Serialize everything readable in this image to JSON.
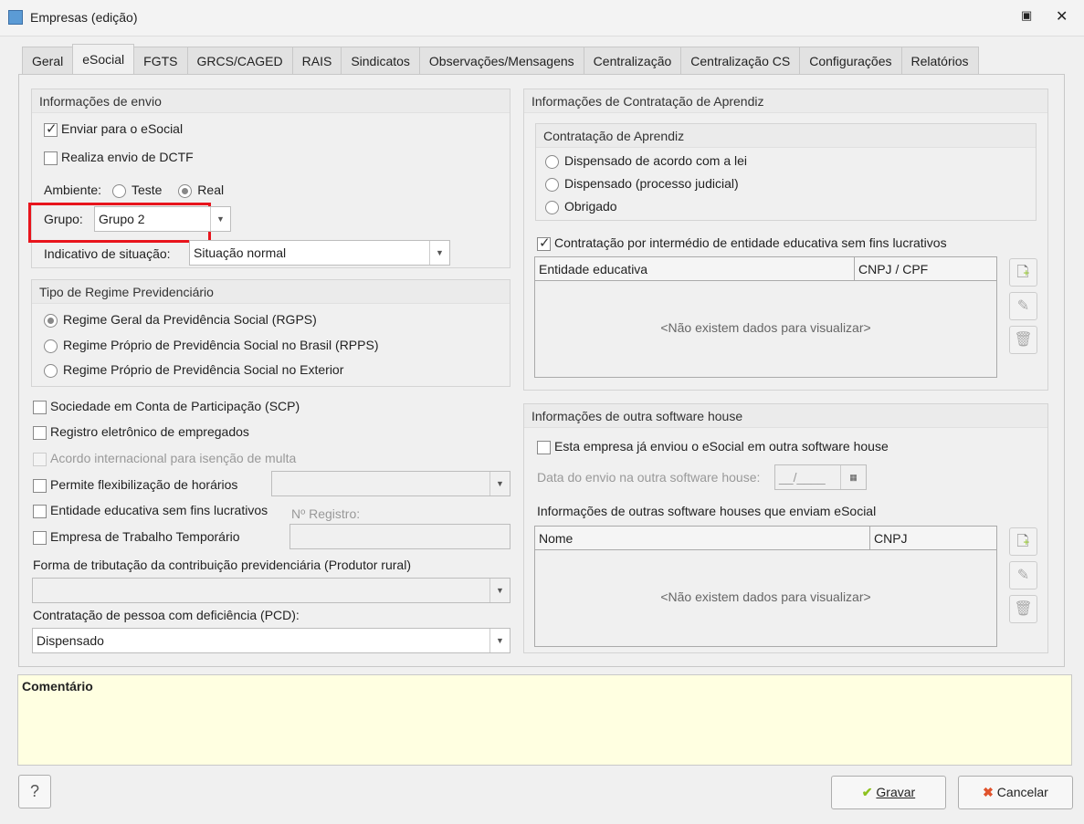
{
  "window": {
    "title": "Empresas (edição)"
  },
  "tabs": [
    "Geral",
    "eSocial",
    "FGTS",
    "GRCS/CAGED",
    "RAIS",
    "Sindicatos",
    "Observações/Mensagens",
    "Centralização",
    "Centralização CS",
    "Configurações",
    "Relatórios"
  ],
  "envio": {
    "title": "Informações de envio",
    "enviar": "Enviar para o eSocial",
    "dctf": "Realiza envio de DCTF",
    "ambiente_label": "Ambiente:",
    "teste": "Teste",
    "real": "Real",
    "grupo_label": "Grupo:",
    "grupo_value": "Grupo 2",
    "indicativo_label": "Indicativo de situação:",
    "indicativo_value": "Situação normal"
  },
  "regime": {
    "title": "Tipo de Regime Previdenciário",
    "options": [
      "Regime Geral da Previdência Social (RGPS)",
      "Regime Próprio de Previdência Social no Brasil (RPPS)",
      "Regime Próprio de Previdência Social no Exterior"
    ]
  },
  "checks": {
    "scp": "Sociedade em Conta de Participação (SCP)",
    "registro": "Registro eletrônico de empregados",
    "acordo": "Acordo internacional para isenção de multa",
    "flex": "Permite flexibilização de horários",
    "entidade": "Entidade educativa sem fins lucrativos",
    "nregistro": "Nº Registro:",
    "temporario": "Empresa de Trabalho Temporário"
  },
  "tributacao": {
    "label": "Forma de tributação da contribuição previdenciária (Produtor rural)",
    "value": ""
  },
  "pcd": {
    "label": "Contratação de pessoa com deficiência (PCD):",
    "value": "Dispensado"
  },
  "aprendiz": {
    "title": "Informações de Contratação de Aprendiz",
    "sub": "Contratação de Aprendiz",
    "options": [
      "Dispensado de acordo com a lei",
      "Dispensado (processo judicial)",
      "Obrigado"
    ],
    "intermedio": "Contratação por intermédio de entidade educativa sem fins lucrativos",
    "col1": "Entidade educativa",
    "col2": "CNPJ / CPF",
    "empty": "<Não existem dados para visualizar>"
  },
  "software": {
    "title": "Informações de outra software house",
    "enviou": "Esta empresa já enviou o eSocial em outra software house",
    "data_label": "Data do envio na outra software house:",
    "data_value": "__/____",
    "outras": "Informações de outras software houses que enviam eSocial",
    "col1": "Nome",
    "col2": "CNPJ",
    "empty": "<Não existem dados para visualizar>"
  },
  "comentario": {
    "label": "Comentário"
  },
  "footer": {
    "help": "?",
    "gravar": "Gravar",
    "cancelar": "Cancelar"
  }
}
